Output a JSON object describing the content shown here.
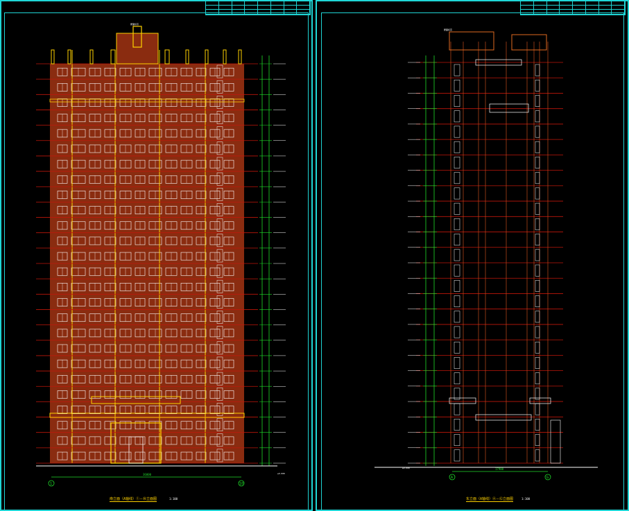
{
  "colors": {
    "background": "#000000",
    "frame": "#1fd6d6",
    "floor_line": "#c0170a",
    "wall": "#8a2c10",
    "yellow": "#ffd200",
    "window": "#ffffff",
    "dimension": "#1fdc2a"
  },
  "sheets": [
    {
      "caption": "南立面（A轴线）①－⑩立面图",
      "scale": "1:100",
      "total_dimension": "36000",
      "axis_left": "1",
      "axis_right": "10",
      "top_marker": "屋面标高"
    },
    {
      "caption": "东立面（A轴线）Ⓐ－Ⓖ立面图",
      "scale": "1:100",
      "total_dimension": "17900",
      "axis_left": "A",
      "axis_right": "G",
      "top_marker": "屋面标高"
    }
  ],
  "floors": 26,
  "ground_level": "±0.000"
}
